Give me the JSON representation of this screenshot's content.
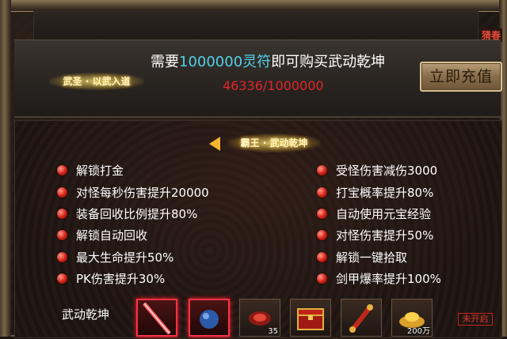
{
  "corner_tag": "猜春",
  "header": {
    "title_badge": "武圣 · 以武入道",
    "need_prefix": "需要",
    "need_amount": "1000000灵符",
    "need_suffix": "即可购买武动乾坤",
    "progress_text": "46336/1000000",
    "recharge_button": "立即充值"
  },
  "panel": {
    "title_badge": "霸王 · 武动乾坤",
    "bonuses_left": [
      "解锁打金",
      "对怪每秒伤害提升20000",
      "装备回收比例提升80%",
      "解锁自动回收",
      "最大生命提升50%",
      "PK伤害提升30%"
    ],
    "bonuses_right": [
      "受怪伤害减伤3000",
      "打宝概率提升80%",
      "自动使用元宝经验",
      "对怪伤害提升50%",
      "解锁一键拾取",
      "剑甲爆率提升100%"
    ],
    "items_label": "武动乾坤",
    "items": [
      {
        "icon": "red-sword-icon",
        "count": ""
      },
      {
        "icon": "blue-orb-icon",
        "count": ""
      },
      {
        "icon": "red-gem-icon",
        "count": "35"
      },
      {
        "icon": "treasure-chest-icon",
        "count": ""
      },
      {
        "icon": "red-scroll-icon",
        "count": ""
      },
      {
        "icon": "gold-ingot-icon",
        "count": "200万"
      }
    ],
    "unopened_label": "未开启"
  },
  "colors": {
    "highlight": "#4fd2ea",
    "progress": "#e0262a",
    "bullet": "#d01d12",
    "badge_glow": "#ffd24d"
  }
}
